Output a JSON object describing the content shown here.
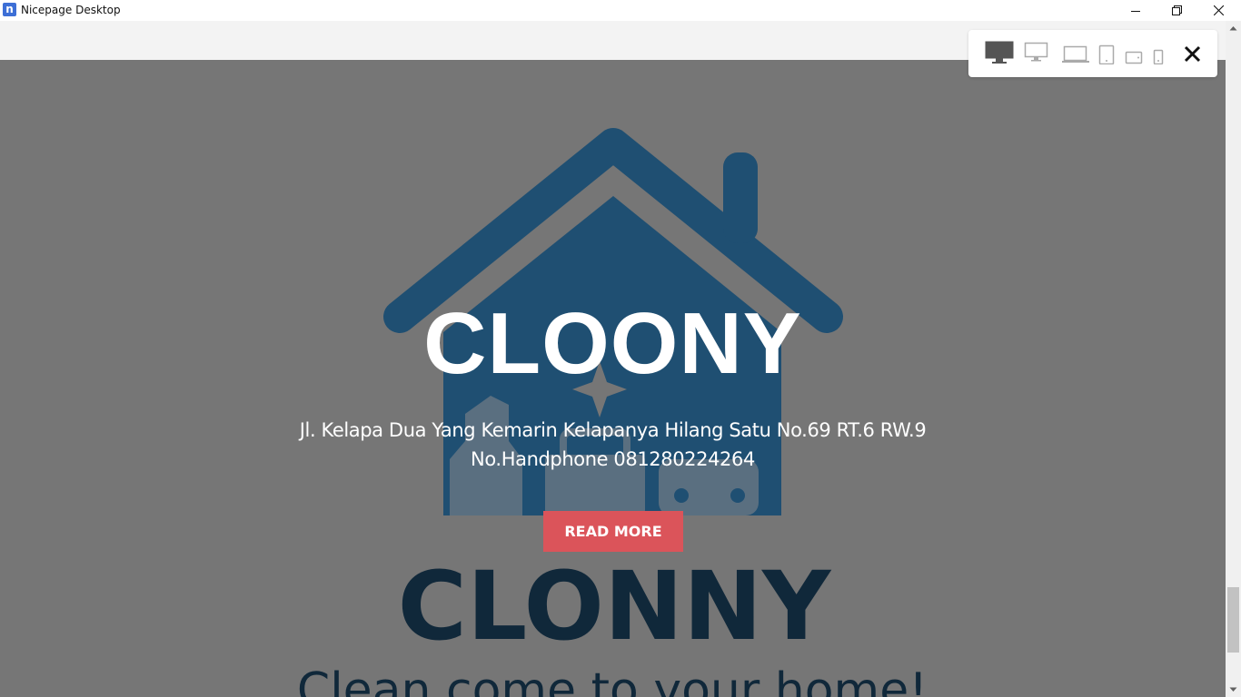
{
  "window": {
    "app_title": "Nicepage Desktop",
    "app_logo_letter": "n"
  },
  "device_toolbar": {
    "devices": [
      "desktop-large-icon",
      "desktop-icon",
      "laptop-icon",
      "tablet-icon",
      "tablet-landscape-icon",
      "phone-icon"
    ],
    "active_device": "desktop-large-icon"
  },
  "hero": {
    "title": "CLOONY",
    "address_line": "Jl. Kelapa Dua Yang Kemarin Kelapanya Hilang Satu No.69 RT.6 RW.9",
    "phone_line": "No.Handphone 081280224264",
    "button_label": "READ MORE",
    "background_logo_text": "CLONNY",
    "background_logo_tagline": "Clean come to your home!",
    "colors": {
      "overlay": "#767676",
      "button": "#db545a",
      "logo_blue": "#1f4f72",
      "logo_dark": "#10283a"
    }
  }
}
